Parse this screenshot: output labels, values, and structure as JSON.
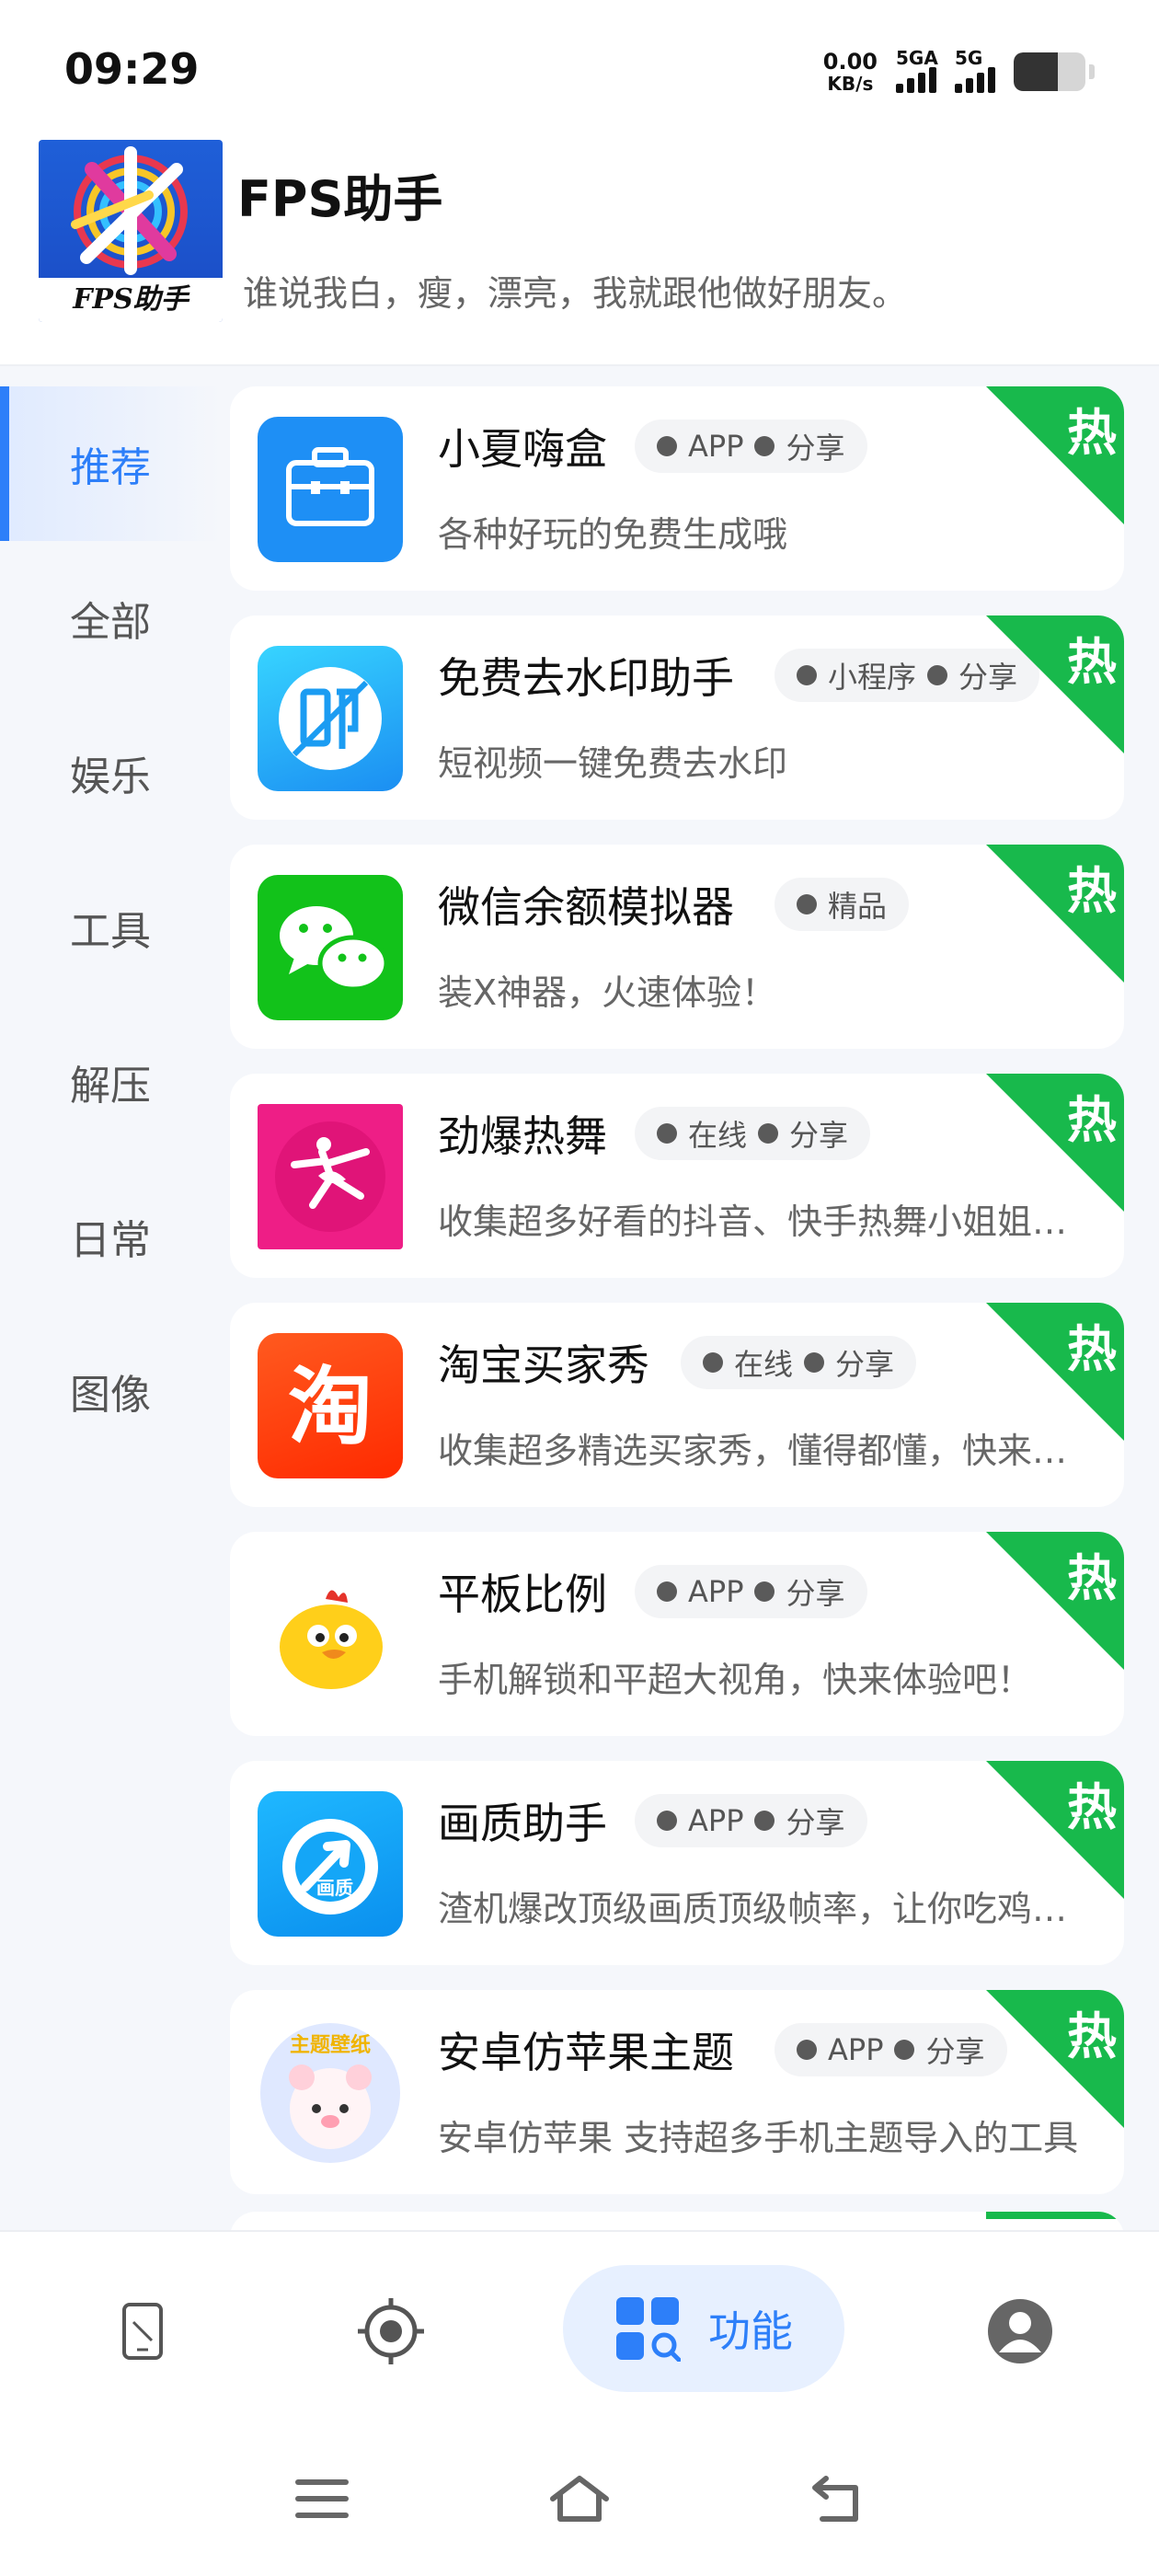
{
  "status_bar": {
    "time": "09:29",
    "net_speed_value": "0.00",
    "net_speed_unit": "KB/s",
    "signal_1_label": "5GA",
    "signal_2_label": "5G",
    "battery_fraction": 0.62
  },
  "header": {
    "logo_text": "FPS助手",
    "title": "FPS助手",
    "slogan": "谁说我白，瘦，漂亮，我就跟他做好朋友。"
  },
  "sidebar": {
    "items": [
      {
        "label": "推荐",
        "active": true
      },
      {
        "label": "全部",
        "active": false
      },
      {
        "label": "娱乐",
        "active": false
      },
      {
        "label": "工具",
        "active": false
      },
      {
        "label": "解压",
        "active": false
      },
      {
        "label": "日常",
        "active": false
      },
      {
        "label": "图像",
        "active": false
      }
    ]
  },
  "list": {
    "hot_label": "热",
    "hot_color": "#18b94c",
    "items": [
      {
        "title": "小夏嗨盒",
        "tags": [
          "APP",
          "分享"
        ],
        "desc": "各种好玩的免费生成哦",
        "icon": "briefcase-icon"
      },
      {
        "title": "免费去水印助手",
        "tags": [
          "小程序",
          "分享"
        ],
        "desc": "短视频一键免费去水印",
        "icon": "watermark-stamp-icon"
      },
      {
        "title": "微信余额模拟器",
        "tags": [
          "精品"
        ],
        "desc": "装X神器，火速体验！",
        "icon": "wechat-icon"
      },
      {
        "title": "劲爆热舞",
        "tags": [
          "在线",
          "分享"
        ],
        "desc": "收集超多好看的抖音、快手热舞小姐姐视频",
        "icon": "dancer-icon"
      },
      {
        "title": "淘宝买家秀",
        "tags": [
          "在线",
          "分享"
        ],
        "desc": "收集超多精选买家秀，懂得都懂，快来看看吧",
        "icon": "taobao-icon"
      },
      {
        "title": "平板比例",
        "tags": [
          "APP",
          "分享"
        ],
        "desc": "手机解锁和平超大视角，快来体验吧！",
        "icon": "chick-icon"
      },
      {
        "title": "画质助手",
        "tags": [
          "APP",
          "分享"
        ],
        "desc": "渣机爆改顶级画质顶级帧率，让你吃鸡更流畅",
        "icon": "quality-arrow-icon"
      },
      {
        "title": "安卓仿苹果主题",
        "tags": [
          "APP",
          "分享"
        ],
        "desc": "安卓仿苹果 支持超多手机主题导入的工具",
        "icon": "theme-bear-icon"
      }
    ]
  },
  "bottom_nav": {
    "items": [
      {
        "icon": "phone-screen-icon",
        "label": ""
      },
      {
        "icon": "crosshair-icon",
        "label": ""
      },
      {
        "icon": "apps-search-icon",
        "label": "功能",
        "active": true
      },
      {
        "icon": "user-avatar-icon",
        "label": ""
      }
    ],
    "accent": "#2d7ff9"
  },
  "system_nav": [
    "menu-icon",
    "home-icon",
    "back-icon"
  ]
}
